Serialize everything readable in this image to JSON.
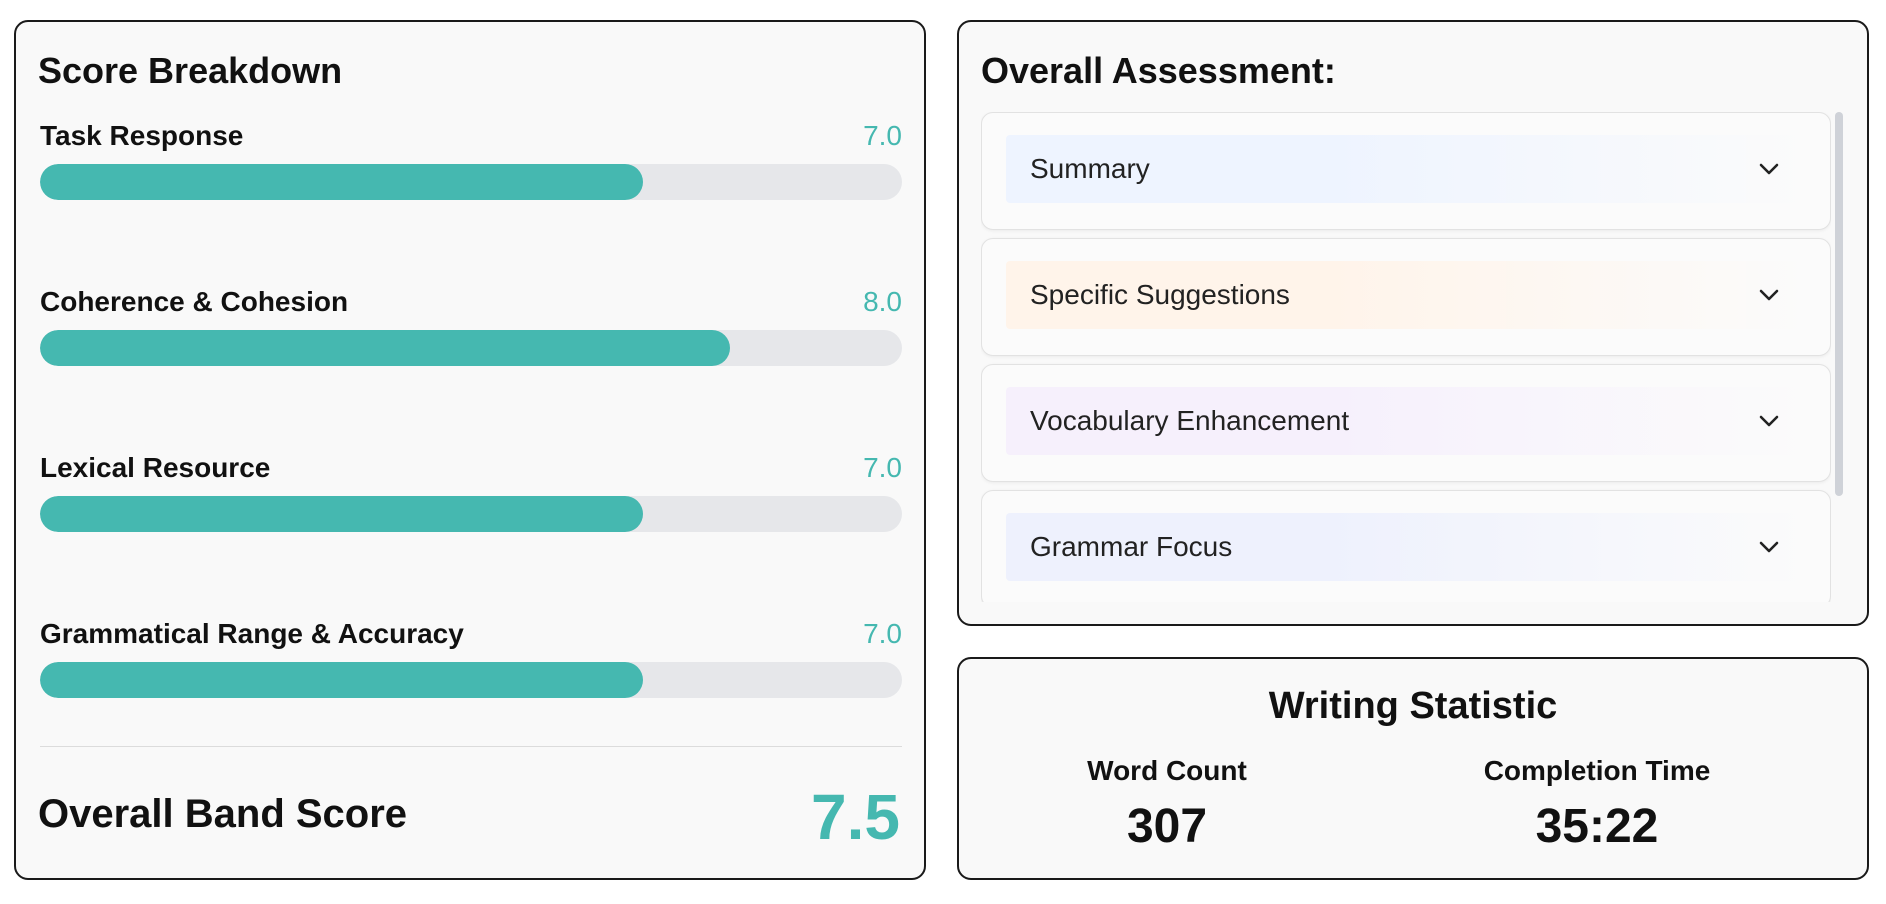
{
  "score_breakdown": {
    "title": "Score Breakdown",
    "criteria": [
      {
        "label": "Task Response",
        "score": "7.0",
        "fraction": 0.7
      },
      {
        "label": "Coherence & Cohesion",
        "score": "8.0",
        "fraction": 0.8
      },
      {
        "label": "Lexical Resource",
        "score": "7.0",
        "fraction": 0.7
      },
      {
        "label": "Grammatical Range & Accuracy",
        "score": "7.0",
        "fraction": 0.7
      }
    ],
    "overall_label": "Overall Band Score",
    "overall_score": "7.5"
  },
  "overall_assessment": {
    "title": "Overall Assessment:",
    "items": [
      {
        "label": "Summary",
        "tint": "#eef4ff"
      },
      {
        "label": "Specific Suggestions",
        "tint": "#fff4ea"
      },
      {
        "label": "Vocabulary Enhancement",
        "tint": "#f6f0fc"
      },
      {
        "label": "Grammar Focus",
        "tint": "#eef1fd"
      }
    ],
    "icon": "chevron-down-icon"
  },
  "writing_statistic": {
    "title": "Writing Statistic",
    "word_count_label": "Word Count",
    "word_count_value": "307",
    "completion_time_label": "Completion Time",
    "completion_time_value": "35:22"
  },
  "colors": {
    "accent": "#45b8b0",
    "track": "#e6e7ea"
  }
}
